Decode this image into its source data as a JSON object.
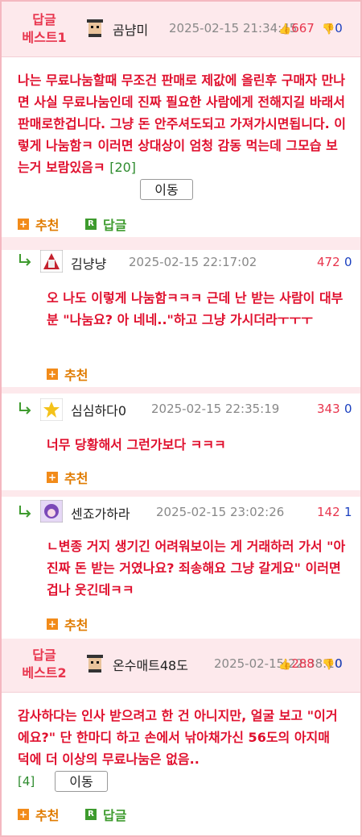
{
  "best1": {
    "badge_top": "답글",
    "badge_bottom": "베스트1",
    "username": "곰냠미",
    "date": "2025-02-15 21:34:45",
    "up": "667",
    "down": "0",
    "body": "나는 무료나눔할때 무조건 판매로 제값에 올린후 구매자 만나면 사실 무료나눔인데 진짜 필요한 사람에게 전해지길 바래서 판매로한겁니다. 그냥 돈 안주셔도되고 가져가시면됩니다. 이렇게 나눔함ㅋ 이러면 상대상이 엄청 감동 먹는데 그모습 보는거 보람있음ㅋ",
    "count": "[20]",
    "move_label": "이동",
    "recommend_label": "추천",
    "reply_label": "답글"
  },
  "replies": [
    {
      "username": "김냥냥",
      "date": "2025-02-15 22:17:02",
      "up": "472",
      "down": "0",
      "body": "오 나도 이렇게 나눔함ㅋㅋㅋ 근데 난 받는 사람이 대부분 \"나눔요? 아 네네..\"하고 그냥 가시더라ㅜㅜㅜ",
      "recommend_label": "추천"
    },
    {
      "username": "심심하다0",
      "date": "2025-02-15 22:35:19",
      "up": "343",
      "down": "0",
      "body": "너무 당황해서 그런가보다 ㅋㅋㅋ",
      "recommend_label": "추천"
    },
    {
      "username": "센죠가하라",
      "date": "2025-02-15 23:02:26",
      "up": "142",
      "down": "1",
      "body": "ㄴ변종 거지 생기긴 어려워보이는 게 거래하러 가서 \"아 진짜 돈 받는 거였나요? 죄송해요 그냥 갈게요\" 이러면 겁나 웃긴데ㅋㅋ",
      "recommend_label": "추천"
    }
  ],
  "best2": {
    "badge_top": "답글",
    "badge_bottom": "베스트2",
    "username": "온수매트48도",
    "date": "2025-02-15 22:38:10",
    "up": "288",
    "down": "0",
    "body": "감사하다는 인사 받으려고 한 건 아니지만, 얼굴 보고 \"이거에요?\" 단 한마디 하고 손에서 낚아채가신 56도의 아지매 덕에 더 이상의 무료나눔은 없음..",
    "count": "[4]",
    "move_label": "이동",
    "recommend_label": "추천",
    "reply_label": "답글"
  },
  "colors": {
    "accent_red": "#e0102e",
    "link_blue": "#1a3fbf",
    "border_pink": "#f4b8c0",
    "recommend_orange": "#e07b00",
    "reply_green": "#3e9b2e"
  }
}
